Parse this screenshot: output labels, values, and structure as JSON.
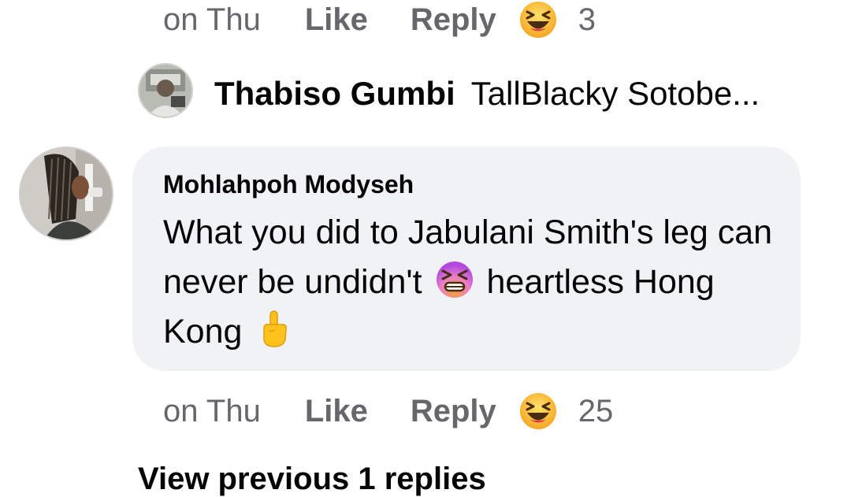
{
  "top_comment_actions": {
    "time": "on Thu",
    "like_label": "Like",
    "reply_label": "Reply",
    "reaction_icon": "laughing-emoji",
    "reaction_count": "3"
  },
  "reply_preview": {
    "author": "Thabiso Gumbi",
    "snippet": "TallBlacky Sotobe..."
  },
  "comment": {
    "author": "Mohlahpoh Modyseh",
    "text_part1": "What you did to Jabulani Smith's leg can never be undidn't",
    "emoji1": "tired-face-emoji",
    "text_part2": "heartless Hong Kong",
    "emoji2": "middle-finger-emoji"
  },
  "comment_actions": {
    "time": "on Thu",
    "like_label": "Like",
    "reply_label": "Reply",
    "reaction_icon": "laughing-emoji",
    "reaction_count": "25"
  },
  "view_more_replies": "View previous 1 replies",
  "colors": {
    "bubble": "#f0f2f5",
    "secondary_text": "#65676b",
    "primary_text": "#050505"
  }
}
